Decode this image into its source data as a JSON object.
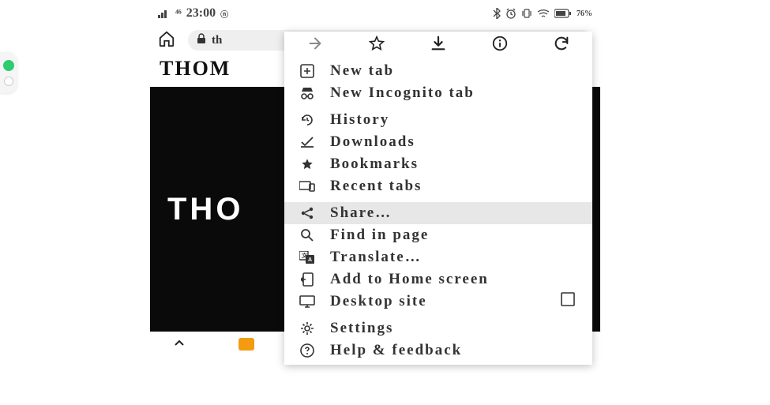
{
  "statusbar": {
    "time": "23:00",
    "signal_left": "⁴⁶",
    "battery_pct": "76%"
  },
  "browserbar": {
    "url_display": "th"
  },
  "page": {
    "title_visible": "THOM",
    "hero_text_visible": "THO"
  },
  "menu": {
    "items": [
      {
        "label": "New tab"
      },
      {
        "label": "New Incognito tab"
      },
      {
        "label": "History"
      },
      {
        "label": "Downloads"
      },
      {
        "label": "Bookmarks"
      },
      {
        "label": "Recent tabs"
      },
      {
        "label": "Share…"
      },
      {
        "label": "Find in page"
      },
      {
        "label": "Translate…"
      },
      {
        "label": "Add to Home screen"
      },
      {
        "label": "Desktop site"
      },
      {
        "label": "Settings"
      },
      {
        "label": "Help & feedback"
      }
    ]
  },
  "bottombar": {
    "plus": "+"
  }
}
